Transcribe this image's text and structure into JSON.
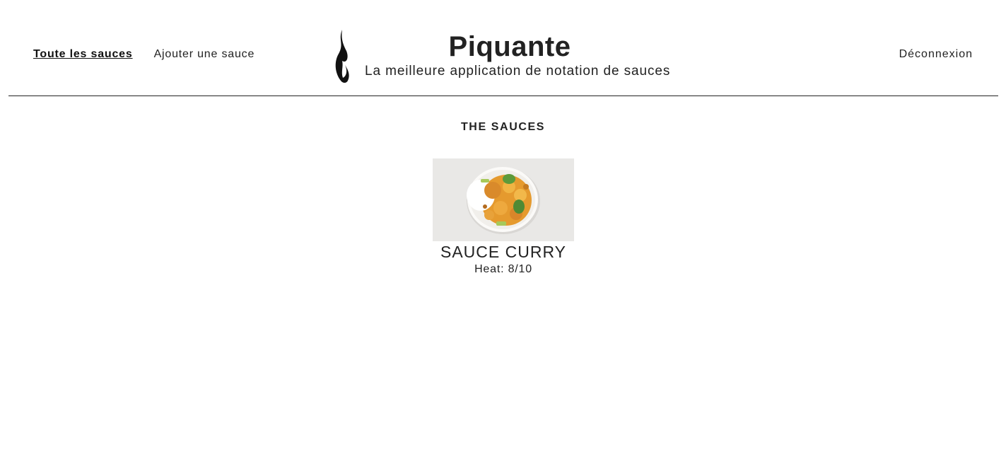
{
  "nav": {
    "all_sauces": "Toute les sauces",
    "add_sauce": "Ajouter une sauce",
    "logout": "Déconnexion"
  },
  "brand": {
    "title": "Piquante",
    "subtitle": "La meilleure application de notation de sauces",
    "logo_icon": "flame-icon"
  },
  "main": {
    "section_title": "THE SAUCES",
    "sauces": [
      {
        "name": "SAUCE CURRY",
        "heat_label": "Heat: 8/10",
        "image": "curry-plate-image"
      }
    ]
  },
  "colors": {
    "text": "#222222",
    "background": "#ffffff",
    "divider": "#222222"
  }
}
